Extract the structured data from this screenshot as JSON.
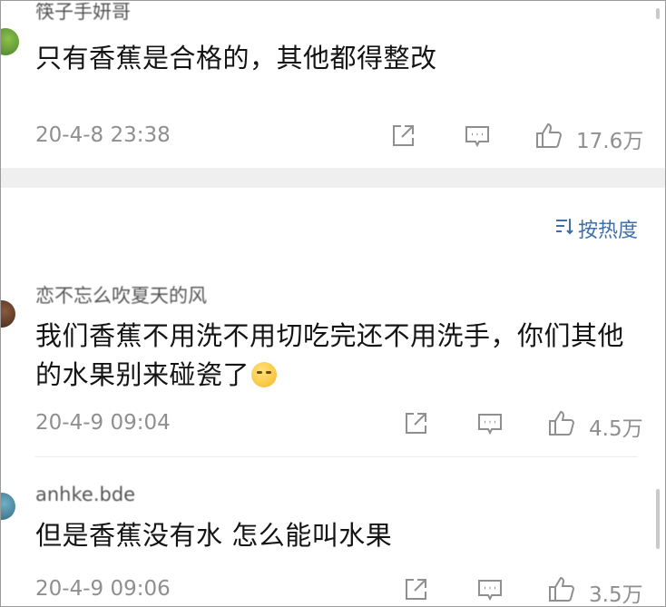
{
  "comments": [
    {
      "username": "筷子手妍哥",
      "text": "只有香蕉是合格的，其他都得整改",
      "time": "20-4-8 23:38",
      "likes": "17.6万"
    },
    {
      "username": "恋不忘么吹夏天的风",
      "text": "我们香蕉不用洗不用切吃完还不用洗手，你们其他的水果别来碰瓷了",
      "time": "20-4-9 09:04",
      "likes": "4.5万"
    },
    {
      "username": "anhke.bde",
      "text": "但是香蕉没有水 怎么能叫水果",
      "time": "20-4-9 09:06",
      "likes": "3.5万"
    }
  ],
  "sort": {
    "icon": "sort-icon",
    "label": "按热度"
  },
  "icons": {
    "share": "share-icon",
    "reply": "comment-icon",
    "like": "thumbs-up-icon",
    "emoji": "sweat-smile-emoji"
  },
  "colors": {
    "accent": "#3f6fa8",
    "meta": "#8f8f8f",
    "divider": "#efefef"
  }
}
